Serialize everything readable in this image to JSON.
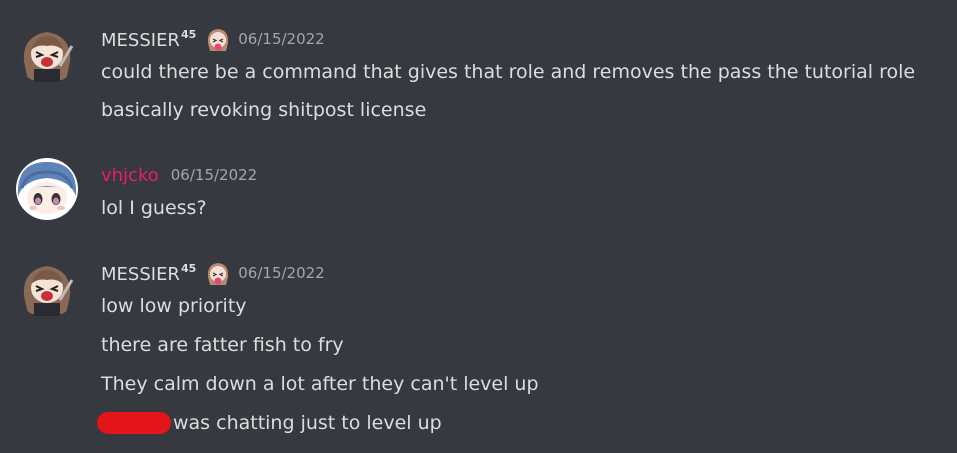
{
  "messages": [
    {
      "author": "MESSIER",
      "author_sup": "45",
      "author_color": "#dcddde",
      "role_icon": "anime-girl-emoji-icon",
      "timestamp": "06/15/2022",
      "lines": [
        "could there be a command that gives that role and removes the pass the tutorial role",
        "basically revoking shitpost license"
      ]
    },
    {
      "author": "vhjcko",
      "author_color": "#e91e63",
      "timestamp": "06/15/2022",
      "lines": [
        "lol I guess?"
      ]
    },
    {
      "author": "MESSIER",
      "author_sup": "45",
      "author_color": "#dcddde",
      "role_icon": "anime-girl-emoji-icon",
      "timestamp": "06/15/2022",
      "lines": [
        "low low priority",
        "there are fatter fish to fry",
        "They calm down a lot after they can't level up",
        "was chatting just to level up"
      ]
    }
  ],
  "colors": {
    "background": "#36393f",
    "message_text": "#dcddde",
    "timestamp": "#a3a6aa",
    "redaction": "#e3141a"
  }
}
